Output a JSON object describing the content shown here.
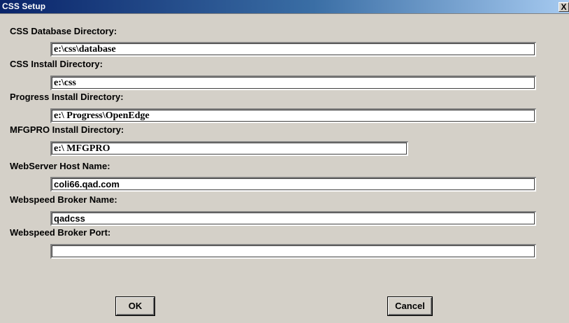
{
  "window": {
    "title": "CSS Setup",
    "close_glyph": "X"
  },
  "fields": [
    {
      "label": "CSS Database Directory:",
      "value": "e:\\css\\database"
    },
    {
      "label": "CSS Install Directory:",
      "value": "e:\\css"
    },
    {
      "label": "Progress Install Directory:",
      "value": "e:\\ Progress\\OpenEdge"
    },
    {
      "label": "MFGPRO Install Directory:",
      "value": "e:\\ MFGPRO"
    },
    {
      "label": "WebServer Host Name:",
      "value": "coli66.qad.com"
    },
    {
      "label": "Webspeed Broker Name:",
      "value": "qadcss"
    },
    {
      "label": "Webspeed Broker Port:",
      "value": ""
    }
  ],
  "buttons": {
    "ok": "OK",
    "cancel": "Cancel"
  }
}
